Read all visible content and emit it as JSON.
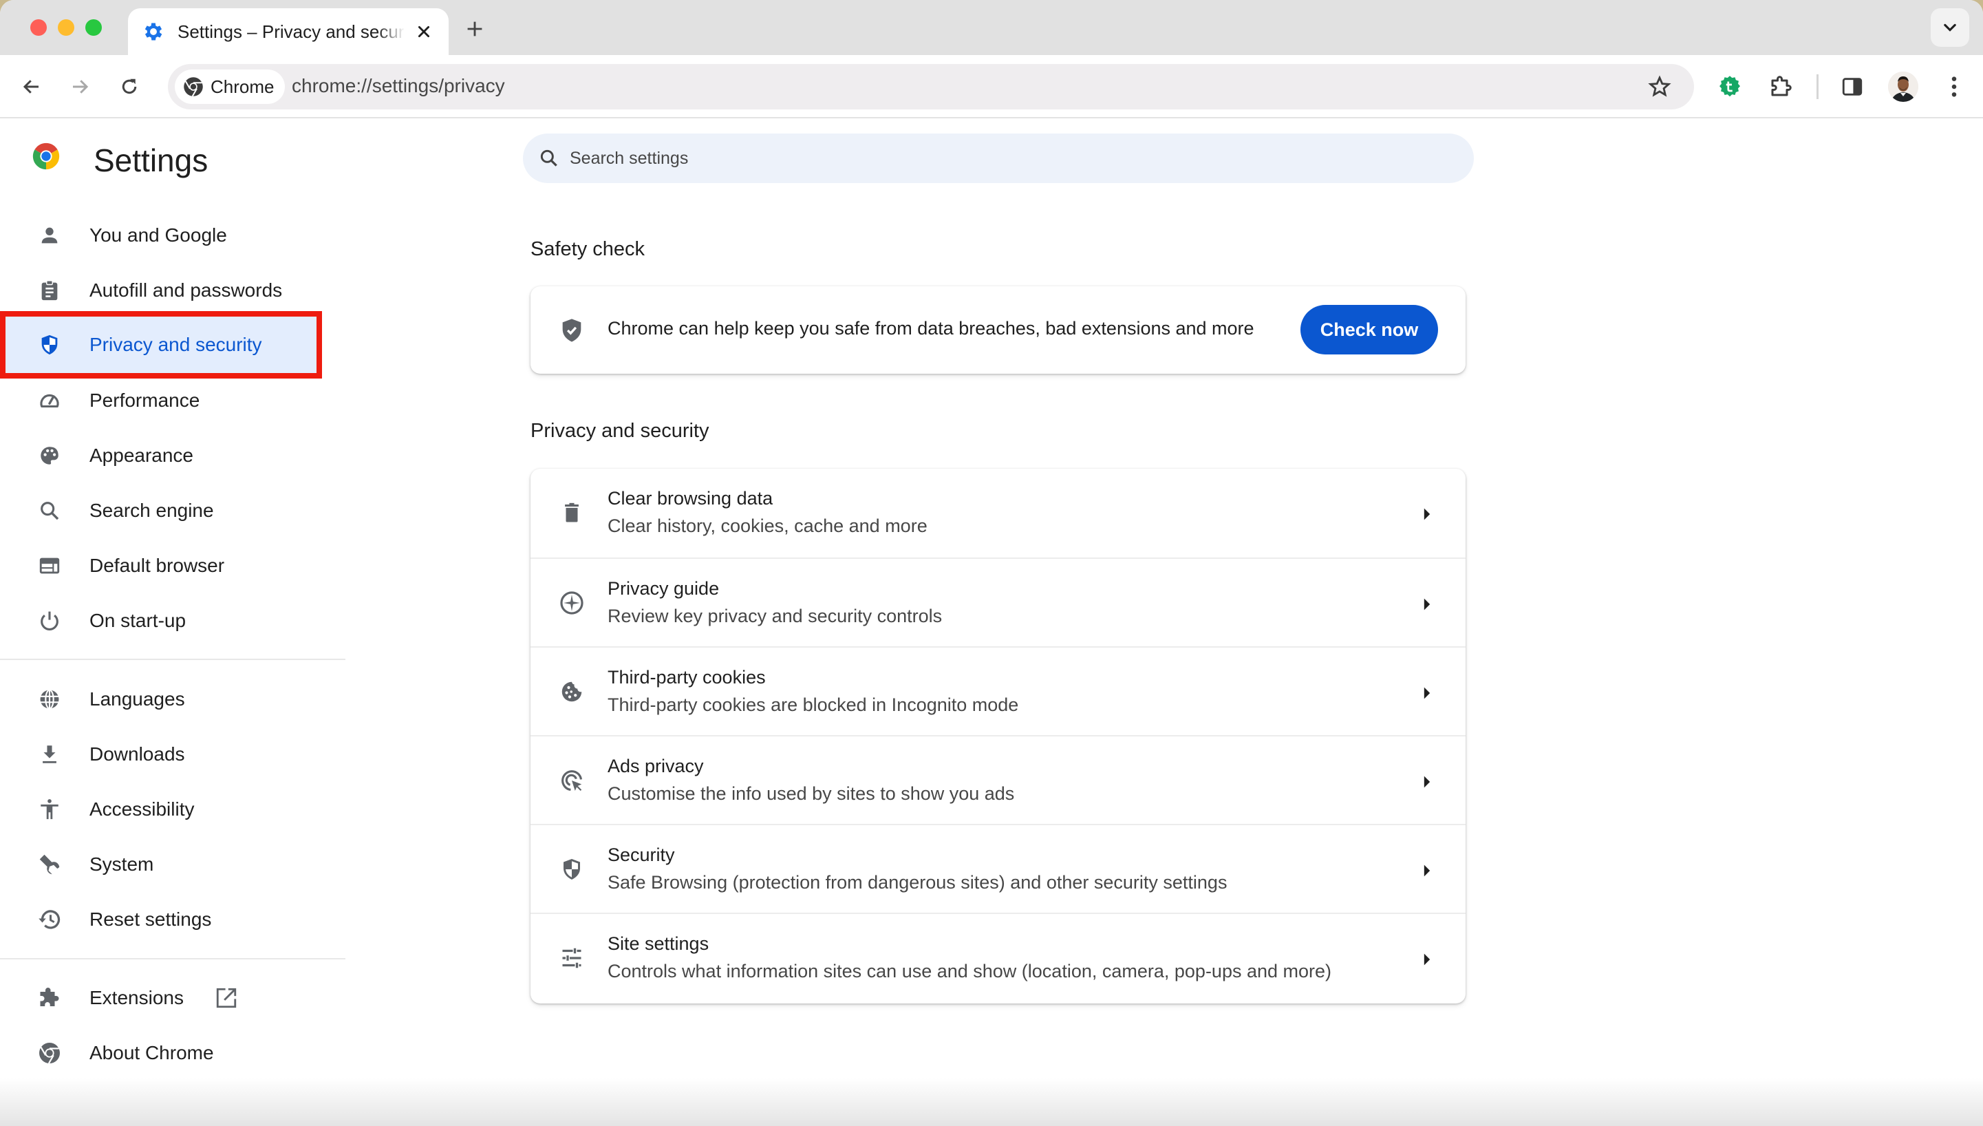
{
  "browser": {
    "tab": {
      "title": "Settings – Privacy and security",
      "icon": "gear-icon"
    },
    "new_tab_label": "+",
    "omnibox": {
      "chip_label": "Chrome",
      "url": "chrome://settings/privacy"
    },
    "colors": {
      "accent": "#0b57d0",
      "tab_icon": "#1a73e8",
      "extension_green": "#16a765",
      "highlight_box": "#ee1c0f"
    }
  },
  "sidebar": {
    "title": "Settings",
    "items": [
      {
        "label": "You and Google",
        "icon": "person-icon"
      },
      {
        "label": "Autofill and passwords",
        "icon": "clipboard-icon"
      },
      {
        "label": "Privacy and security",
        "icon": "shield-icon",
        "active": true
      },
      {
        "label": "Performance",
        "icon": "speedometer-icon"
      },
      {
        "label": "Appearance",
        "icon": "palette-icon"
      },
      {
        "label": "Search engine",
        "icon": "search-icon"
      },
      {
        "label": "Default browser",
        "icon": "browser-window-icon"
      },
      {
        "label": "On start-up",
        "icon": "power-icon"
      },
      {
        "label": "Languages",
        "icon": "globe-icon"
      },
      {
        "label": "Downloads",
        "icon": "download-icon"
      },
      {
        "label": "Accessibility",
        "icon": "accessibility-icon"
      },
      {
        "label": "System",
        "icon": "wrench-icon"
      },
      {
        "label": "Reset settings",
        "icon": "history-icon"
      },
      {
        "label": "Extensions",
        "icon": "puzzle-icon"
      },
      {
        "label": "About Chrome",
        "icon": "chrome-icon"
      }
    ]
  },
  "search": {
    "placeholder": "Search settings",
    "value": ""
  },
  "safety_check": {
    "title": "Safety check",
    "text": "Chrome can help keep you safe from data breaches, bad extensions and more",
    "button": "Check now"
  },
  "privacy": {
    "title": "Privacy and security",
    "rows": [
      {
        "title": "Clear browsing data",
        "subtitle": "Clear history, cookies, cache and more",
        "icon": "trash-icon"
      },
      {
        "title": "Privacy guide",
        "subtitle": "Review key privacy and security controls",
        "icon": "compass-icon"
      },
      {
        "title": "Third-party cookies",
        "subtitle": "Third-party cookies are blocked in Incognito mode",
        "icon": "cookie-icon"
      },
      {
        "title": "Ads privacy",
        "subtitle": "Customise the info used by sites to show you ads",
        "icon": "ads-target-icon"
      },
      {
        "title": "Security",
        "subtitle": "Safe Browsing (protection from dangerous sites) and other security settings",
        "icon": "shield-icon"
      },
      {
        "title": "Site settings",
        "subtitle": "Controls what information sites can use and show (location, camera, pop-ups and more)",
        "icon": "sliders-icon"
      }
    ]
  }
}
